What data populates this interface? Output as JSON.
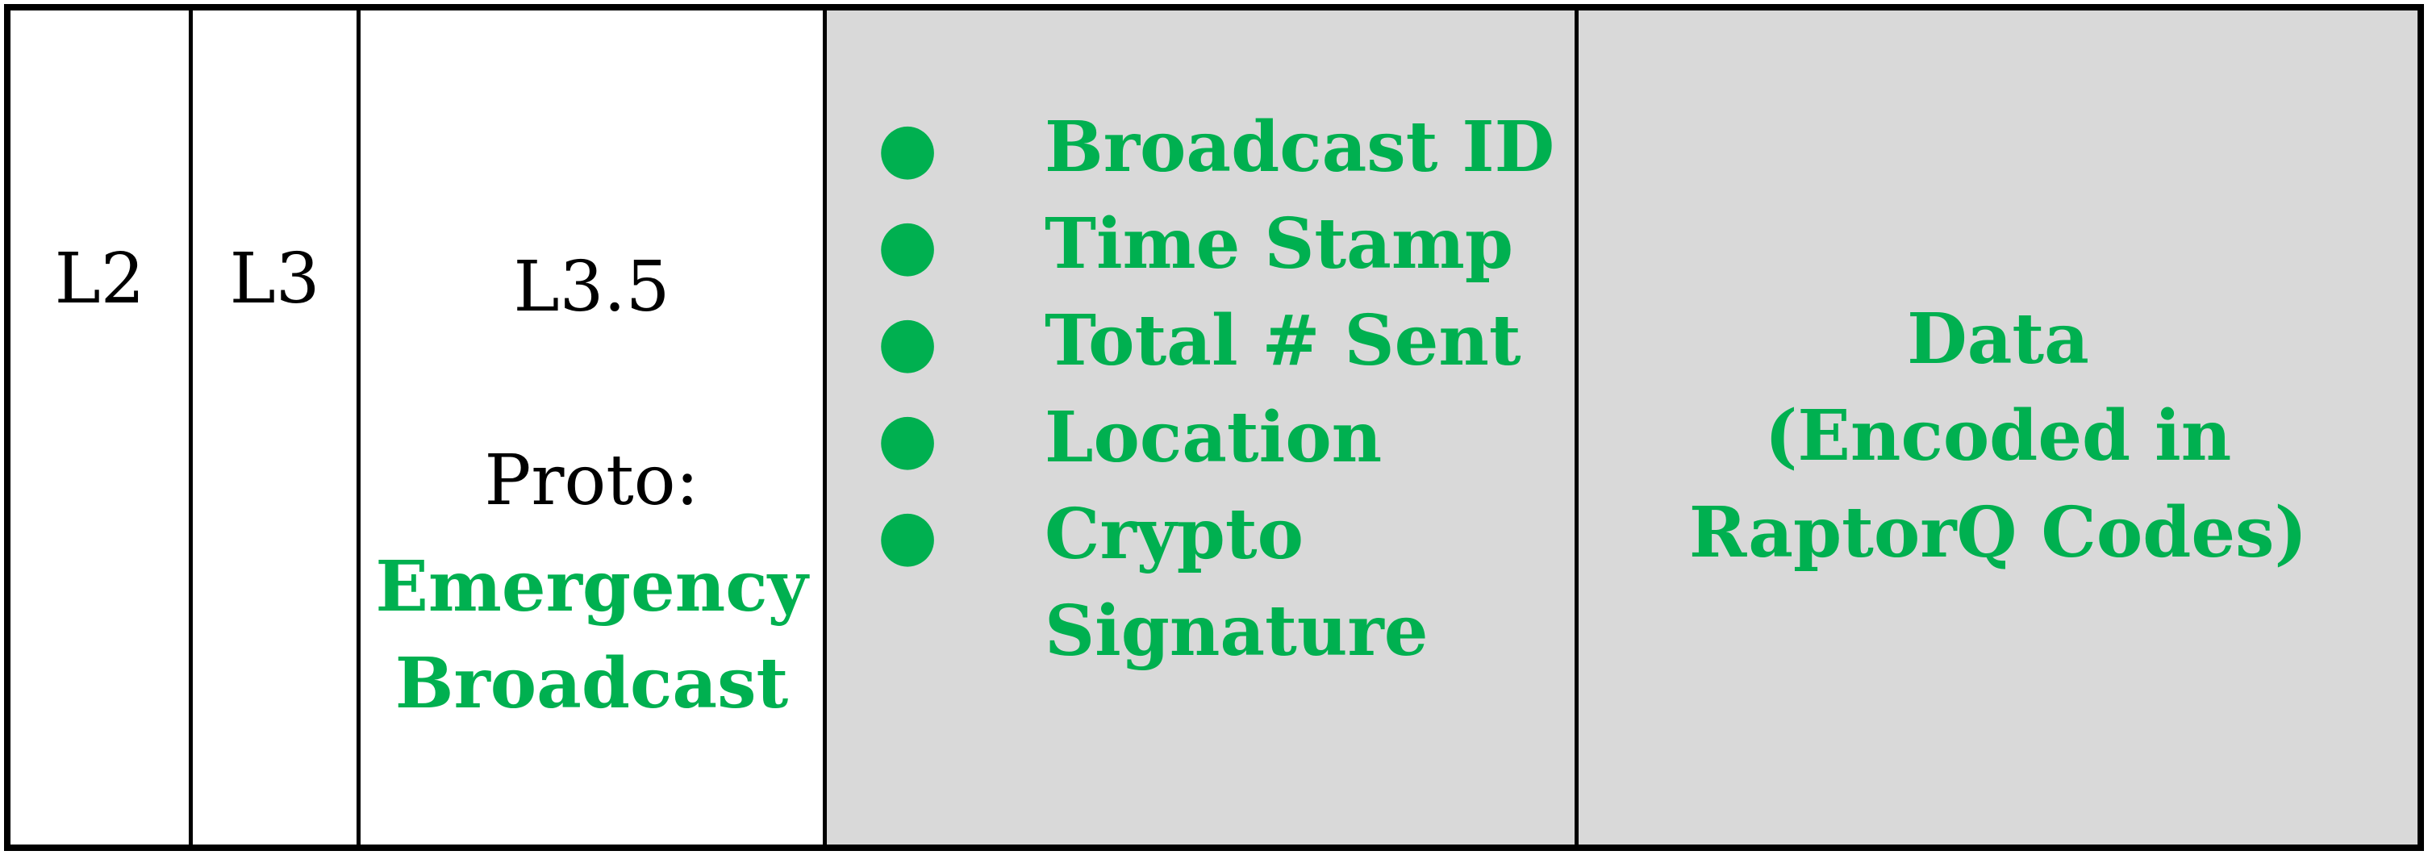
{
  "colors": {
    "accent_green": "#00b050",
    "header_fill": "#d9d9d9",
    "border": "#000000"
  },
  "packet": {
    "l2": "L2",
    "l3": "L3",
    "l35": {
      "label": "L3.5",
      "proto_label": "Proto:",
      "proto_value_line1": "Emergency",
      "proto_value_line2": "Broadcast"
    },
    "header_fields": [
      {
        "label": "Broadcast ID"
      },
      {
        "label": "Time Stamp"
      },
      {
        "label": "Total # Sent"
      },
      {
        "label": "Location"
      },
      {
        "label": "Crypto",
        "continuation": "Signature"
      }
    ],
    "payload": {
      "line1": "Data",
      "line2": "(Encoded in",
      "line3": "RaptorQ Codes)"
    }
  }
}
